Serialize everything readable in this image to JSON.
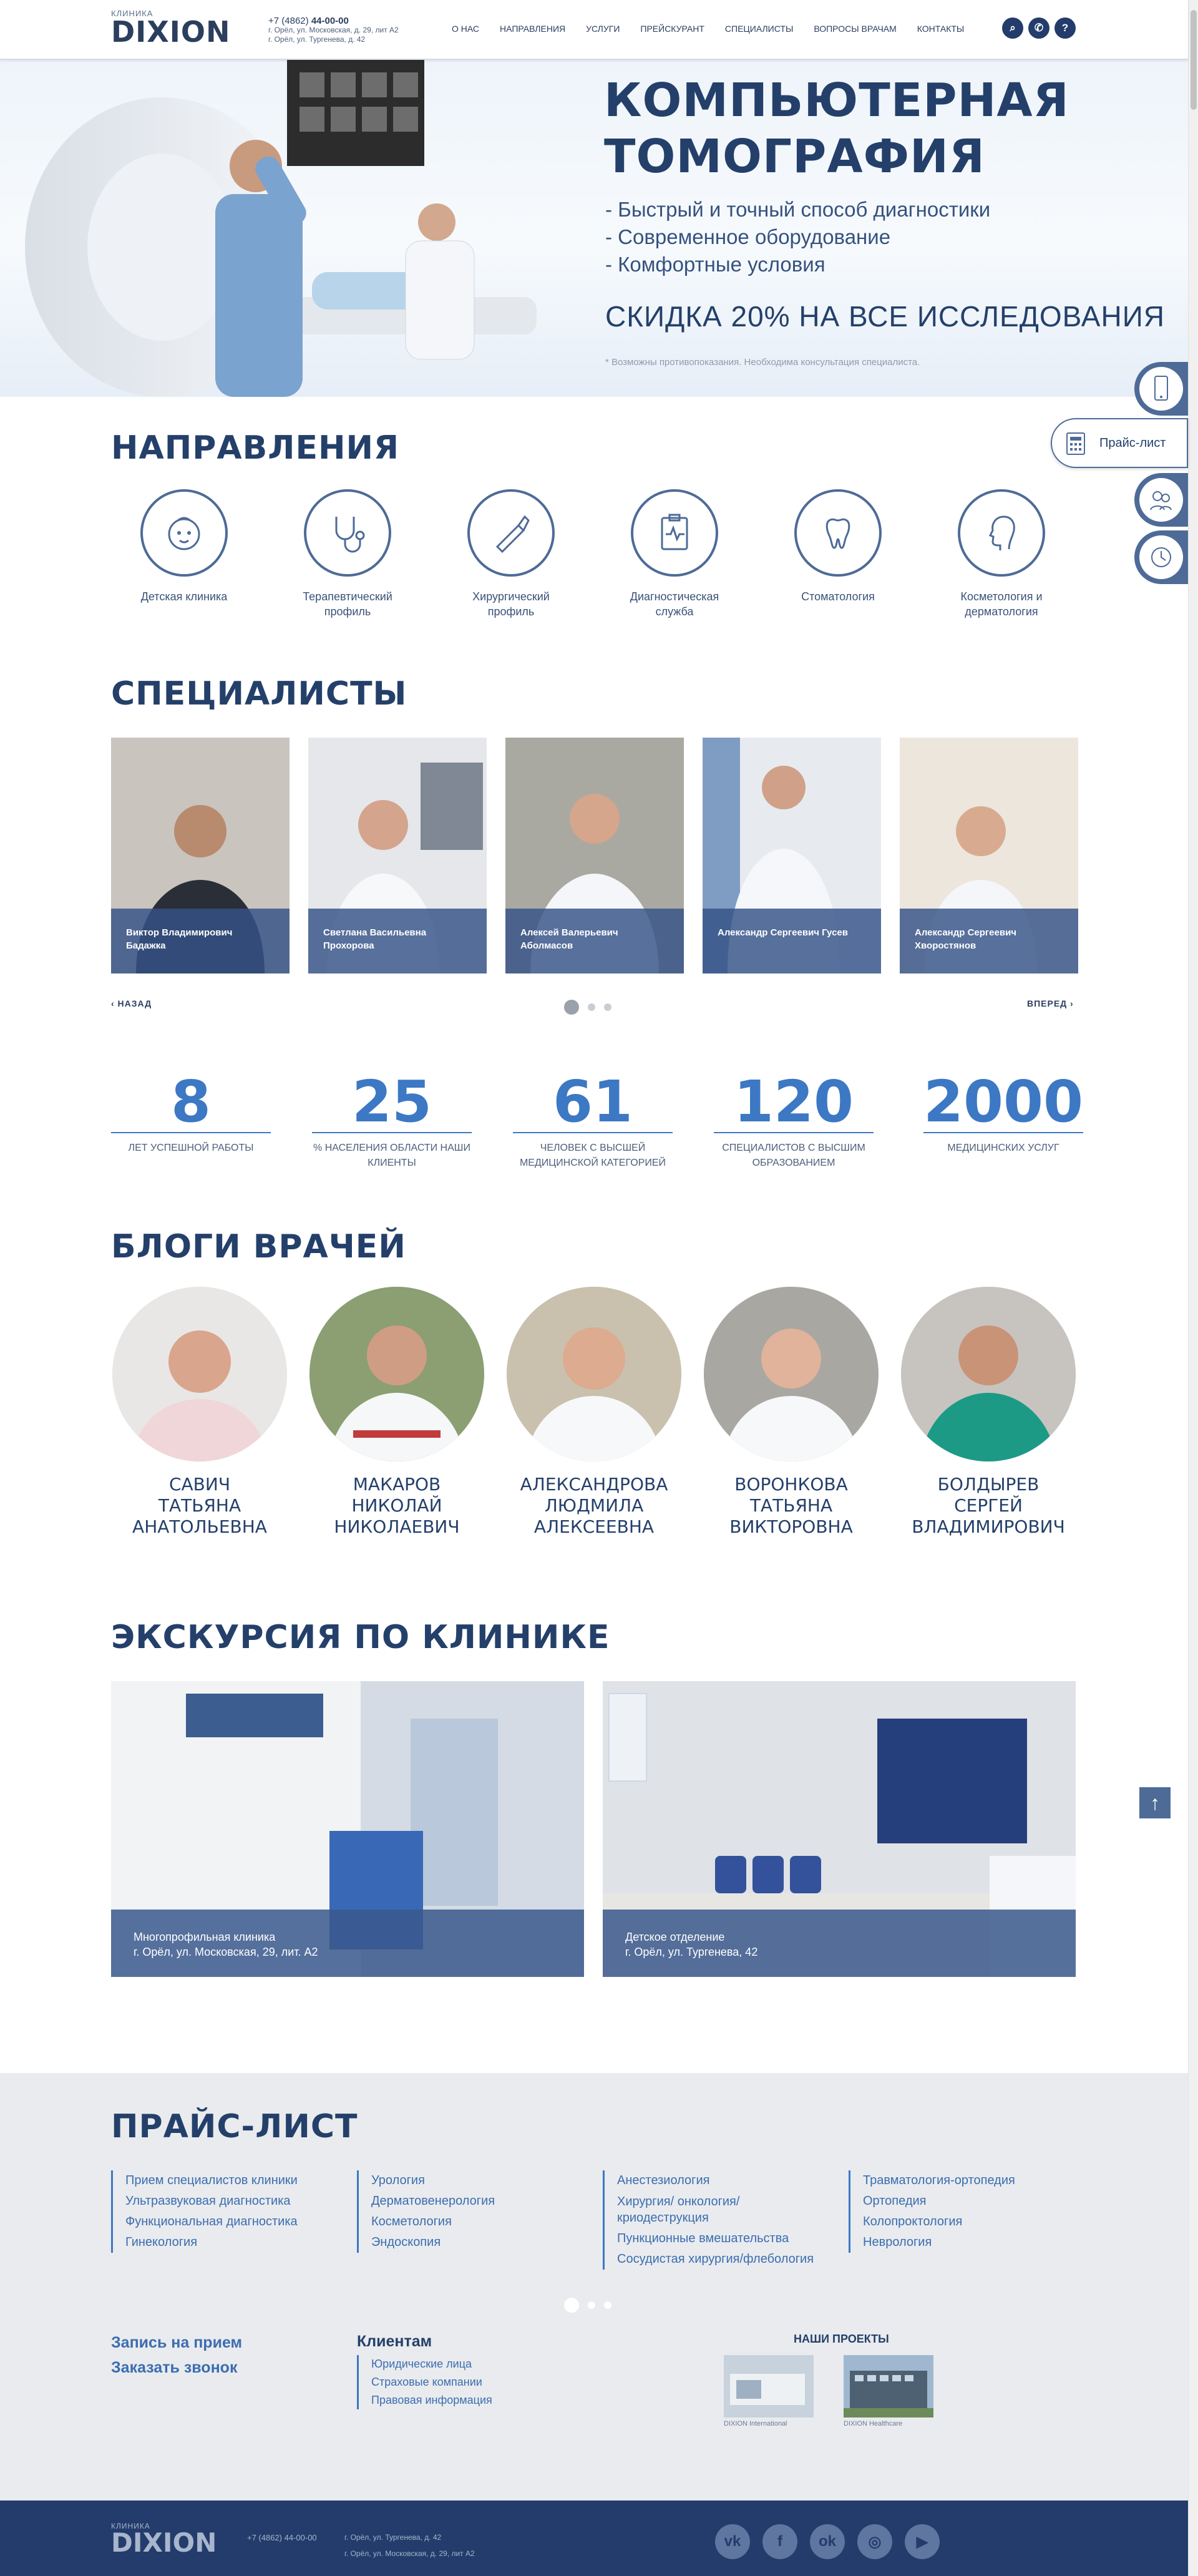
{
  "header": {
    "logo_small": "КЛИНИКА",
    "logo_big": "DIXION",
    "phone_prefix": "+7 (4862)",
    "phone_number": "44-00-00",
    "address1": "г. Орёл, ул. Московская, д. 29, лит А2",
    "address2": "г. Орёл, ул. Тургенева, д. 42",
    "nav": [
      "О НАС",
      "НАПРАВЛЕНИЯ",
      "УСЛУГИ",
      "ПРЕЙСКУРАНТ",
      "СПЕЦИАЛИСТЫ",
      "ВОПРОСЫ ВРАЧАМ",
      "КОНТАКТЫ"
    ],
    "icons": [
      "search-icon",
      "phone-icon",
      "help-icon"
    ]
  },
  "hero": {
    "title_line1": "КОМПЬЮТЕРНАЯ",
    "title_line2": "ТОМОГРАФИЯ",
    "bullets": [
      "- Быстрый и точный способ диагностики",
      "- Современное оборудование",
      "- Комфортные условия"
    ],
    "promo": "СКИДКА 20% НА ВСЕ ИССЛЕДОВАНИЯ",
    "note": "* Возможны противопоказания. Необходима консультация специалиста."
  },
  "side_widgets": {
    "price_label": "Прайс-лист",
    "icons": [
      "mobile-icon",
      "price-list-icon",
      "doctors-icon",
      "clock-icon"
    ]
  },
  "directions": {
    "title": "НАПРАВЛЕНИЯ",
    "items": [
      {
        "label": "Детская клиника",
        "icon": "baby-icon"
      },
      {
        "label": "Терапевтический профиль",
        "icon": "stethoscope-icon"
      },
      {
        "label": "Хирургический профиль",
        "icon": "scalpel-icon"
      },
      {
        "label": "Диагностическая служба",
        "icon": "clipboard-icon"
      },
      {
        "label": "Стоматология",
        "icon": "tooth-icon"
      },
      {
        "label": "Косметология и дерматология",
        "icon": "face-icon"
      }
    ]
  },
  "specialists": {
    "title": "СПЕЦИАЛИСТЫ",
    "items": [
      "Виктор Владимирович Бадажка",
      "Светлана Васильевна Прохорова",
      "Алексей Валерьевич Аболмасов",
      "Александр Сергеевич Гусев",
      "Александр Сергеевич Хворостянов"
    ],
    "prev": "‹ НАЗАД",
    "next": "ВПЕРЕД ›"
  },
  "stats": [
    {
      "num": "8",
      "label": "ЛЕТ УСПЕШНОЙ РАБОТЫ"
    },
    {
      "num": "25",
      "label": "% НАСЕЛЕНИЯ ОБЛАСТИ НАШИ КЛИЕНТЫ"
    },
    {
      "num": "61",
      "label": "ЧЕЛОВЕК С ВЫСШЕЙ МЕДИЦИНСКОЙ КАТЕГОРИЕЙ"
    },
    {
      "num": "120",
      "label": "СПЕЦИАЛИСТОВ С ВЫСШИМ ОБРАЗОВАНИЕМ"
    },
    {
      "num": "2000",
      "label": "МЕДИЦИНСКИХ УСЛУГ"
    }
  ],
  "blogs": {
    "title": "БЛОГИ ВРАЧЕЙ",
    "items": [
      {
        "l1": "САВИЧ",
        "l2": "ТАТЬЯНА",
        "l3": "АНАТОЛЬЕВНА"
      },
      {
        "l1": "МАКАРОВ",
        "l2": "НИКОЛАЙ",
        "l3": "НИКОЛАЕВИЧ"
      },
      {
        "l1": "АЛЕКСАНДРОВА",
        "l2": "ЛЮДМИЛА",
        "l3": "АЛЕКСЕЕВНА"
      },
      {
        "l1": "ВОРОНКОВА",
        "l2": "ТАТЬЯНА",
        "l3": "ВИКТОРОВНА"
      },
      {
        "l1": "БОЛДЫРЕВ",
        "l2": "СЕРГЕЙ",
        "l3": "ВЛАДИМИРОВИЧ"
      }
    ]
  },
  "tour": {
    "title": "ЭКСКУРСИЯ ПО КЛИНИКЕ",
    "items": [
      {
        "l1": "Многопрофильная клиника",
        "l2": "г. Орёл, ул. Московская, 29, лит. А2"
      },
      {
        "l1": "Детское отделение",
        "l2": "г. Орёл, ул. Тургенева, 42"
      }
    ]
  },
  "price_list": {
    "title": "ПРАЙС-ЛИСТ",
    "columns": [
      [
        "Прием специалистов клиники",
        "Ультразвуковая диагностика",
        "Функциональная диагностика",
        "Гинекология"
      ],
      [
        "Урология",
        "Дерматовенерология",
        "Косметология",
        "Эндоскопия"
      ],
      [
        "Анестезиология",
        "Хирургия/ онкология/",
        "криодеструкция",
        "Пункционные вмешательства",
        "Сосудистая хирургия/флебология"
      ],
      [
        "Травматология-ортопедия",
        "Ортопедия",
        "Колопроктология",
        "Неврология"
      ]
    ]
  },
  "footer_links": {
    "appointment": "Запись на прием",
    "callback": "Заказать звонок",
    "clients_title": "Клиентам",
    "clients": [
      "Юридические лица",
      "Страховые компании",
      "Правовая информация"
    ],
    "projects_title": "НАШИ ПРОЕКТЫ",
    "projects": [
      "DIXION International",
      "DIXION Healthcare"
    ]
  },
  "footer": {
    "logo_small": "КЛИНИКА",
    "logo_big": "DIXION",
    "phone": "+7 (4862) 44-00-00",
    "address1": "г. Орёл, ул. Тургенева, д. 42",
    "address2": "г. Орёл, ул. Московская, д. 29, лит А2",
    "social": [
      "vk-icon",
      "facebook-icon",
      "odnoklassniki-icon",
      "instagram-icon",
      "youtube-icon"
    ]
  },
  "colors": {
    "brand": "#24406a",
    "accent": "#3c78c4",
    "footer": "#233c6c"
  }
}
